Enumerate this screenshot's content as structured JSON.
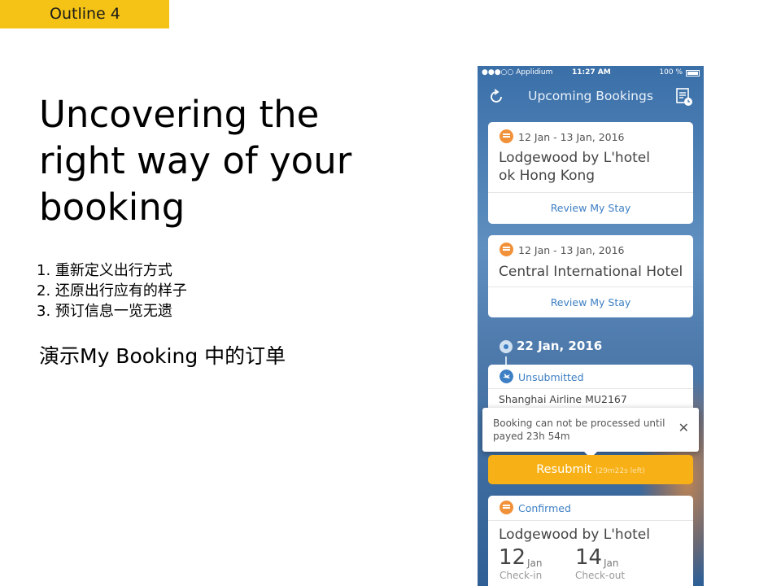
{
  "slide": {
    "tag": "Outline 4",
    "title_lines": [
      "Uncovering the",
      "right way of your",
      "booking"
    ],
    "points": [
      "1. 重新定义出行方式",
      "2. 还原出行应有的样子",
      "3. 预订信息一览无遗"
    ],
    "demo": "演示My Booking 中的订单"
  },
  "phone": {
    "status": {
      "carrier": "●●●○○ Applidium",
      "time": "11:27 AM",
      "battery": "100 %"
    },
    "nav": {
      "title": "Upcoming Bookings",
      "refresh_icon": "refresh-icon",
      "calendar_icon": "calendar-list-icon"
    },
    "bookings": [
      {
        "dates": "12 Jan - 13 Jan, 2016",
        "name_lines": [
          "Lodgewood by L'hotel",
          "ok Hong Kong"
        ],
        "action": "Review My Stay"
      },
      {
        "dates": "12 Jan - 13 Jan, 2016",
        "name_lines": [
          "Central International Hotel"
        ],
        "action": "Review My Stay"
      }
    ],
    "section_date": "22 Jan, 2016",
    "flight": {
      "status": "Unsubmitted",
      "airline": "Shanghai Airline MU2167"
    },
    "tooltip": {
      "text": "Booking can not be processed until payed 23h 54m",
      "close": "✕"
    },
    "resubmit": {
      "label": "Resubmit",
      "timer": "(29m22s left)"
    },
    "confirmed": {
      "status": "Confirmed",
      "name": "Lodgewood by L'hotel",
      "checkin": {
        "day": "12",
        "month": "Jan",
        "label": "Check-in"
      },
      "checkout": {
        "day": "14",
        "month": "Jan",
        "label": "Check-out"
      }
    },
    "colors": {
      "accent_orange": "#f1923a",
      "resubmit_yellow": "#f7b016",
      "link_blue": "#3d7fc4",
      "tag_yellow": "#f5c316"
    }
  }
}
